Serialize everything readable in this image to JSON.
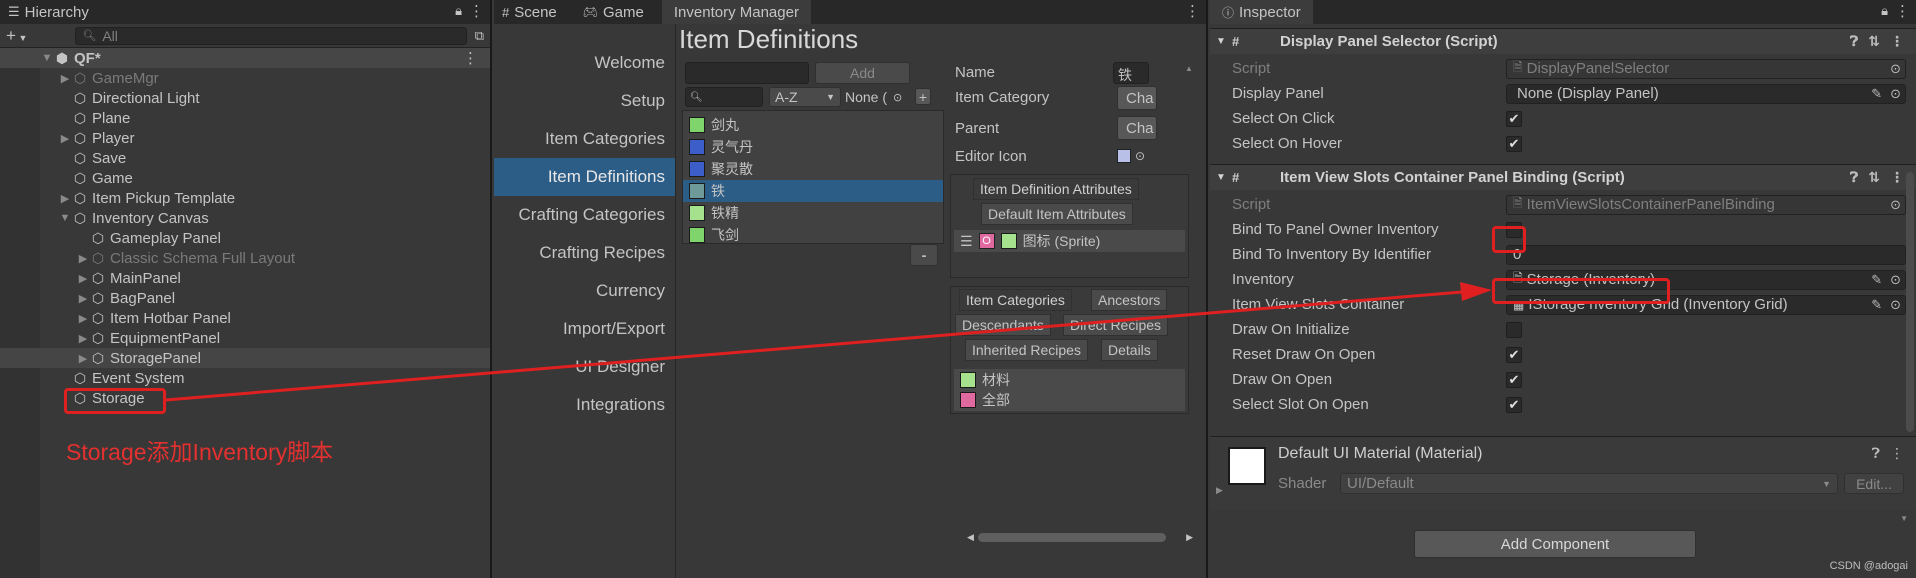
{
  "hierarchy": {
    "tab": "Hierarchy",
    "add": "+",
    "search_placeholder": "All",
    "root": "QF*",
    "items": [
      {
        "label": "GameMgr",
        "dim": true,
        "arrow": true,
        "indent": 1
      },
      {
        "label": "Directional Light",
        "dim": false,
        "arrow": false,
        "indent": 1
      },
      {
        "label": "Plane",
        "dim": false,
        "arrow": false,
        "indent": 1
      },
      {
        "label": "Player",
        "dim": false,
        "arrow": true,
        "indent": 1
      },
      {
        "label": "Save",
        "dim": false,
        "arrow": false,
        "indent": 1
      },
      {
        "label": "Game",
        "dim": false,
        "arrow": false,
        "indent": 1
      },
      {
        "label": "Item Pickup Template",
        "dim": false,
        "arrow": true,
        "indent": 1
      },
      {
        "label": "Inventory Canvas",
        "dim": false,
        "arrow": "open",
        "indent": 1
      },
      {
        "label": "Gameplay Panel",
        "dim": false,
        "arrow": false,
        "indent": 2
      },
      {
        "label": "Classic Schema Full Layout",
        "dim": true,
        "arrow": true,
        "indent": 2
      },
      {
        "label": "MainPanel",
        "dim": false,
        "arrow": true,
        "indent": 2
      },
      {
        "label": "BagPanel",
        "dim": false,
        "arrow": true,
        "indent": 2
      },
      {
        "label": "Item Hotbar Panel",
        "dim": false,
        "arrow": true,
        "indent": 2
      },
      {
        "label": "EquipmentPanel",
        "dim": false,
        "arrow": true,
        "indent": 2
      },
      {
        "label": "StoragePanel",
        "dim": false,
        "arrow": true,
        "indent": 2,
        "sel": true
      },
      {
        "label": "Event System",
        "dim": false,
        "arrow": false,
        "indent": 1
      },
      {
        "label": "Storage",
        "dim": false,
        "arrow": false,
        "indent": 1
      }
    ],
    "annotation": "Storage添加Inventory脚本"
  },
  "inventory_manager": {
    "tabs": [
      "Scene",
      "Game",
      "Inventory Manager"
    ],
    "nav": [
      "Welcome",
      "Setup",
      "Item Categories",
      "Item Definitions",
      "Crafting Categories",
      "Crafting Recipes",
      "Currency",
      "Import/Export",
      "UI Designer",
      "Integrations"
    ],
    "nav_selected": "Item Definitions",
    "title": "Item Definitions",
    "add_label": "Add",
    "sort_label": "A-Z",
    "filter_label": "None (",
    "plus": "+",
    "items": [
      {
        "label": "剑丸",
        "color": "#7fd46b"
      },
      {
        "label": "灵气丹",
        "color": "#3c5ec9"
      },
      {
        "label": "聚灵散",
        "color": "#3c5ec9"
      },
      {
        "label": "铁",
        "color": "#6f9a9a",
        "sel": true
      },
      {
        "label": "铁精",
        "color": "#a6e28d"
      },
      {
        "label": "飞剑",
        "color": "#7fd46b"
      }
    ],
    "minus": "-",
    "props": {
      "name_label": "Name",
      "name_value": "铁",
      "category_label": "Item Category",
      "category_btn": "Cha",
      "parent_label": "Parent",
      "parent_btn": "Cha",
      "icon_label": "Editor Icon"
    },
    "attr_tabs": [
      "Item Definition Attributes",
      "Default Item Attributes"
    ],
    "attr_row": "图标 (Sprite)",
    "cat_tabs_row1": [
      "Item Categories",
      "Ancestors"
    ],
    "cat_tabs_row2": [
      "Descendants",
      "Direct Recipes"
    ],
    "cat_tabs_row3": [
      "Inherited Recipes",
      "Details"
    ],
    "categories": [
      {
        "label": "材料",
        "color": "#a6e28d"
      },
      {
        "label": "全部",
        "color": "#e06aa0"
      }
    ]
  },
  "inspector": {
    "tab": "Inspector",
    "comp1": {
      "title": "Display Panel Selector (Script)",
      "rows": [
        {
          "label": "Script",
          "type": "obj",
          "value": "DisplayPanelSelector",
          "dim": true
        },
        {
          "label": "Display Panel",
          "type": "obj",
          "value": "None (Display Panel)"
        },
        {
          "label": "Select On Click",
          "type": "check",
          "checked": true
        },
        {
          "label": "Select On Hover",
          "type": "check",
          "checked": true
        }
      ]
    },
    "comp2": {
      "title": "Item View Slots Container Panel Binding (Script)",
      "rows": [
        {
          "label": "Script",
          "type": "obj",
          "value": "ItemViewSlotsContainerPanelBinding",
          "dim": true
        },
        {
          "label": "Bind To Panel Owner Inventory",
          "type": "check",
          "checked": false
        },
        {
          "label": "Bind To Inventory By Identifier",
          "type": "text",
          "value": "0"
        },
        {
          "label": "Inventory",
          "type": "obj",
          "value": "Storage (Inventory)"
        },
        {
          "label": "Item View Slots Container",
          "type": "obj",
          "value": "IStorage nventory Grid (Inventory Grid)"
        },
        {
          "label": "Draw On Initialize",
          "type": "check",
          "checked": false
        },
        {
          "label": "Reset Draw On Open",
          "type": "check",
          "checked": true
        },
        {
          "label": "Draw On Open",
          "type": "check",
          "checked": true
        },
        {
          "label": "Select Slot On Open",
          "type": "check",
          "checked": true
        }
      ]
    },
    "material": {
      "title": "Default UI Material (Material)",
      "shader_label": "Shader",
      "shader_value": "UI/Default",
      "edit_label": "Edit..."
    },
    "add_component": "Add Component",
    "watermark": "CSDN @adogai"
  }
}
